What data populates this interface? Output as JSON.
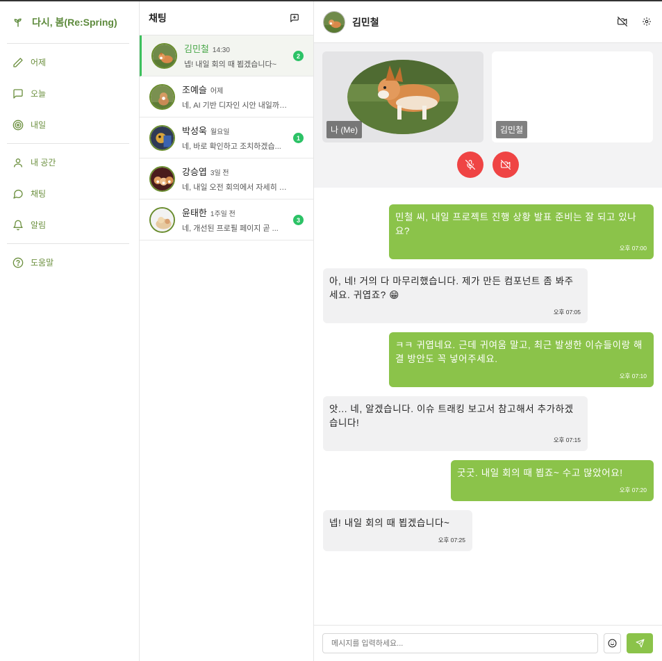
{
  "brand": {
    "name": "다시, 봄(Re:Spring)"
  },
  "sidebar": {
    "items": [
      {
        "label": "어제",
        "icon": "pencil-icon"
      },
      {
        "label": "오늘",
        "icon": "message-square-icon"
      },
      {
        "label": "내일",
        "icon": "target-icon"
      },
      {
        "label": "내 공간",
        "icon": "user-icon"
      },
      {
        "label": "채팅",
        "icon": "chat-bubble-icon"
      },
      {
        "label": "알림",
        "icon": "bell-icon"
      },
      {
        "label": "도움말",
        "icon": "help-circle-icon"
      }
    ]
  },
  "chatlist": {
    "title": "채팅",
    "items": [
      {
        "name": "김민철",
        "time": "14:30",
        "preview": "넵! 내일 회의 때 뵙겠습니다~",
        "badge": "2"
      },
      {
        "name": "조예슬",
        "time": "어제",
        "preview": "네, AI 기반 디자인 시안 내일까지...",
        "badge": ""
      },
      {
        "name": "박성욱",
        "time": "월요일",
        "preview": "네, 바로 확인하고 조치하겠습...",
        "badge": "1"
      },
      {
        "name": "강승엽",
        "time": "3일 전",
        "preview": "네, 내일 오전 회의에서 자세히 논...",
        "badge": ""
      },
      {
        "name": "윤태한",
        "time": "1주일 전",
        "preview": "네, 개선된 프로필 페이지 곧 ...",
        "badge": "3"
      }
    ]
  },
  "main": {
    "contact_name": "김민철",
    "video": {
      "me_label": "나 (Me)",
      "peer_label": "김민철"
    },
    "messages": [
      {
        "side": "sent",
        "text": "민철 씨, 내일 프로젝트 진행 상황 발표 준비는 잘 되고 있나요?",
        "time": "오후 07:00"
      },
      {
        "side": "recv",
        "text": "아, 네! 거의 다 마무리했습니다. 제가 만든 컴포넌트 좀 봐주세요. 귀엽죠? 😁",
        "time": "오후 07:05"
      },
      {
        "side": "sent",
        "text": "ㅋㅋ 귀엽네요. 근데 귀여움 말고, 최근 발생한 이슈들이랑 해결 방안도 꼭 넣어주세요.",
        "time": "오후 07:10"
      },
      {
        "side": "recv",
        "text": "앗... 네, 알겠습니다. 이슈 트래킹 보고서 참고해서 추가하겠습니다!",
        "time": "오후 07:15"
      },
      {
        "side": "sent",
        "text": "굿굿. 내일 회의 때 뵙죠~ 수고 많았어요!",
        "time": "오후 07:20"
      },
      {
        "side": "recv",
        "text": "넵! 내일 회의 때 뵙겠습니다~",
        "time": "오후 07:25"
      }
    ],
    "composer": {
      "placeholder": "메시지를 입력하세요..."
    }
  },
  "colors": {
    "accent": "#8bc34a",
    "brand": "#5d8a3c",
    "badge": "#2cc266",
    "danger": "#ef4444"
  }
}
